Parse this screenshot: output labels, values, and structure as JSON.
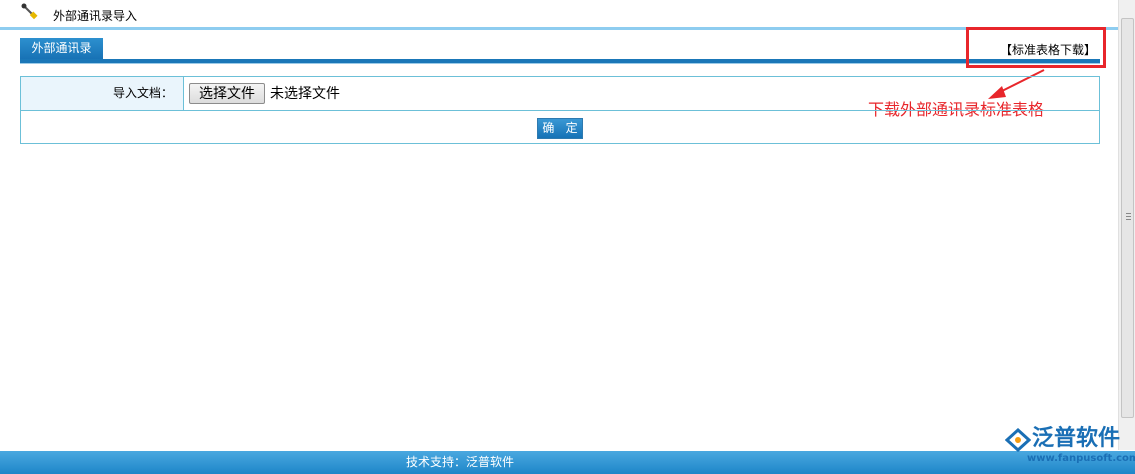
{
  "header": {
    "title": "外部通讯录导入",
    "icon": "tool-icon"
  },
  "tabs": {
    "active_label": "外部通讯录",
    "download_link": "【标准表格下载】"
  },
  "form": {
    "label": "导入文档：",
    "file_button": "选择文件",
    "file_status": "未选择文件",
    "confirm_button": "确 定"
  },
  "annotation": {
    "text": "下载外部通讯录标准表格",
    "color": "#e8262b"
  },
  "footer": {
    "text": "技术支持：泛普软件"
  },
  "logo": {
    "name": "泛普软件",
    "url": "www.fanpusoft.com"
  },
  "colors": {
    "accent": "#1a77b8",
    "border": "#6cc0d8"
  }
}
